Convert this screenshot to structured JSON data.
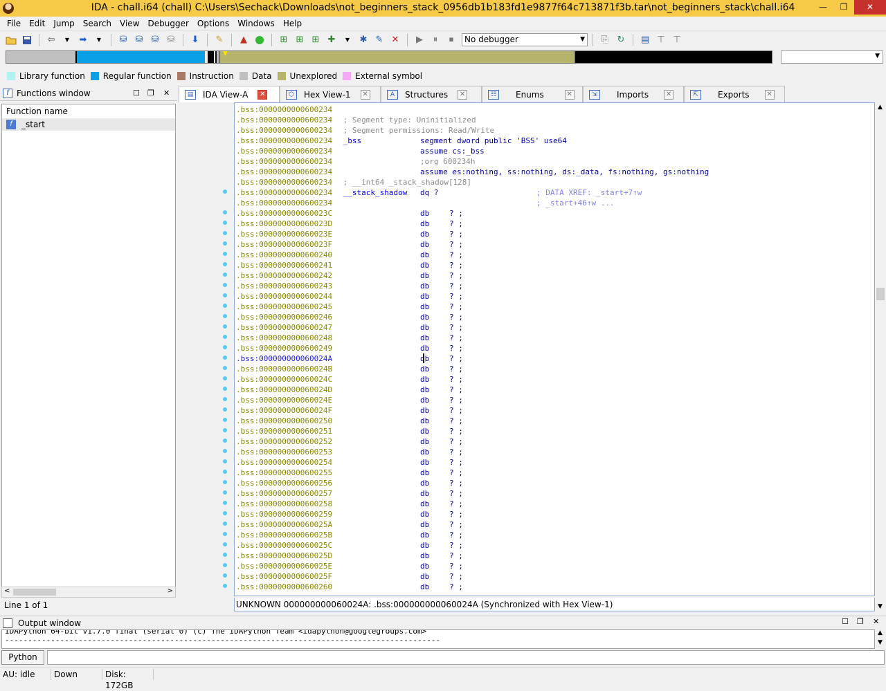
{
  "window": {
    "title": "IDA - chall.i64 (chall) C:\\Users\\Sechack\\Downloads\\not_beginners_stack_0956db1b183fd1e9877f64c713871f3b.tar\\not_beginners_stack\\chall.i64",
    "minimize": "—",
    "restore": "❐",
    "close": "✕"
  },
  "menu": [
    "File",
    "Edit",
    "Jump",
    "Search",
    "View",
    "Debugger",
    "Options",
    "Windows",
    "Help"
  ],
  "toolbar": {
    "debugger_select": "No debugger"
  },
  "legend": [
    {
      "label": "Library function",
      "color": "#b3f2f2"
    },
    {
      "label": "Regular function",
      "color": "#0aa0e6"
    },
    {
      "label": "Instruction",
      "color": "#a87c64"
    },
    {
      "label": "Data",
      "color": "#c0c0c0"
    },
    {
      "label": "Unexplored",
      "color": "#b5b36c"
    },
    {
      "label": "External symbol",
      "color": "#f6a9f6"
    }
  ],
  "functions_window": {
    "title": "Functions window",
    "column": "Function name",
    "items": [
      "_start"
    ],
    "line_info": "Line 1 of 1"
  },
  "tabs": [
    {
      "label": "IDA View-A",
      "icon": "ida-view-icon"
    },
    {
      "label": "Hex View-1",
      "icon": "hex-view-icon"
    },
    {
      "label": "Structures",
      "icon": "structures-icon"
    },
    {
      "label": "Enums",
      "icon": "enums-icon"
    },
    {
      "label": "Imports",
      "icon": "imports-icon"
    },
    {
      "label": "Exports",
      "icon": "exports-icon"
    }
  ],
  "disasm": {
    "header_lines": [
      {
        "addr": ".bss:0000000000600234",
        "text": ""
      },
      {
        "addr": ".bss:0000000000600234",
        "text": " ; Segment type: Uninitialized",
        "cls": "cmt"
      },
      {
        "addr": ".bss:0000000000600234",
        "text": " ; Segment permissions: Read/Write",
        "cls": "cmt"
      },
      {
        "addr": ".bss:0000000000600234",
        "label": " _bss",
        "text": "segment dword public 'BSS' use64",
        "cls": "kw"
      },
      {
        "addr": ".bss:0000000000600234",
        "text": "assume cs:_bss",
        "cls": "kw"
      },
      {
        "addr": ".bss:0000000000600234",
        "text": ";org 600234h",
        "cls": "cmt"
      },
      {
        "addr": ".bss:0000000000600234",
        "text": "assume es:nothing, ss:nothing, ds:_data, fs:nothing, gs:nothing",
        "cls": "kw"
      },
      {
        "addr": ".bss:0000000000600234",
        "text": " ; __int64 _stack_shadow[128]",
        "cls": "cmt"
      },
      {
        "addr": ".bss:0000000000600234",
        "label": " __stack_shadow",
        "text": "dq ?",
        "cls": "kw",
        "xref": "; DATA XREF: _start+7↑w"
      },
      {
        "addr": ".bss:0000000000600234",
        "text": "",
        "xref": "; _start+46↑w ..."
      }
    ],
    "db_lines": [
      ".bss:000000000060023C",
      ".bss:000000000060023D",
      ".bss:000000000060023E",
      ".bss:000000000060023F",
      ".bss:0000000000600240",
      ".bss:0000000000600241",
      ".bss:0000000000600242",
      ".bss:0000000000600243",
      ".bss:0000000000600244",
      ".bss:0000000000600245",
      ".bss:0000000000600246",
      ".bss:0000000000600247",
      ".bss:0000000000600248",
      ".bss:0000000000600249",
      ".bss:000000000060024A",
      ".bss:000000000060024B",
      ".bss:000000000060024C",
      ".bss:000000000060024D",
      ".bss:000000000060024E",
      ".bss:000000000060024F",
      ".bss:0000000000600250",
      ".bss:0000000000600251",
      ".bss:0000000000600252",
      ".bss:0000000000600253",
      ".bss:0000000000600254",
      ".bss:0000000000600255",
      ".bss:0000000000600256",
      ".bss:0000000000600257",
      ".bss:0000000000600258",
      ".bss:0000000000600259",
      ".bss:000000000060025A",
      ".bss:000000000060025B",
      ".bss:000000000060025C",
      ".bss:000000000060025D",
      ".bss:000000000060025E",
      ".bss:000000000060025F",
      ".bss:0000000000600260"
    ],
    "db_mnemonic": "db",
    "db_operand": "? ;",
    "current_address": ".bss:000000000060024A"
  },
  "status_line": "UNKNOWN 000000000060024A: .bss:000000000060024A (Synchronized with Hex View-1)",
  "output_window": {
    "title": "Output window",
    "line1": "IDAPython 64-bit v1.7.0 final (serial 0) (c) The IDAPython Team <idapython@googlegroups.com>",
    "line2": "-----------------------------------------------------------------------------------------------",
    "python_button": "Python"
  },
  "statusbar": {
    "au": "AU:  idle",
    "dir": "Down",
    "disk": "Disk: 172GB"
  }
}
